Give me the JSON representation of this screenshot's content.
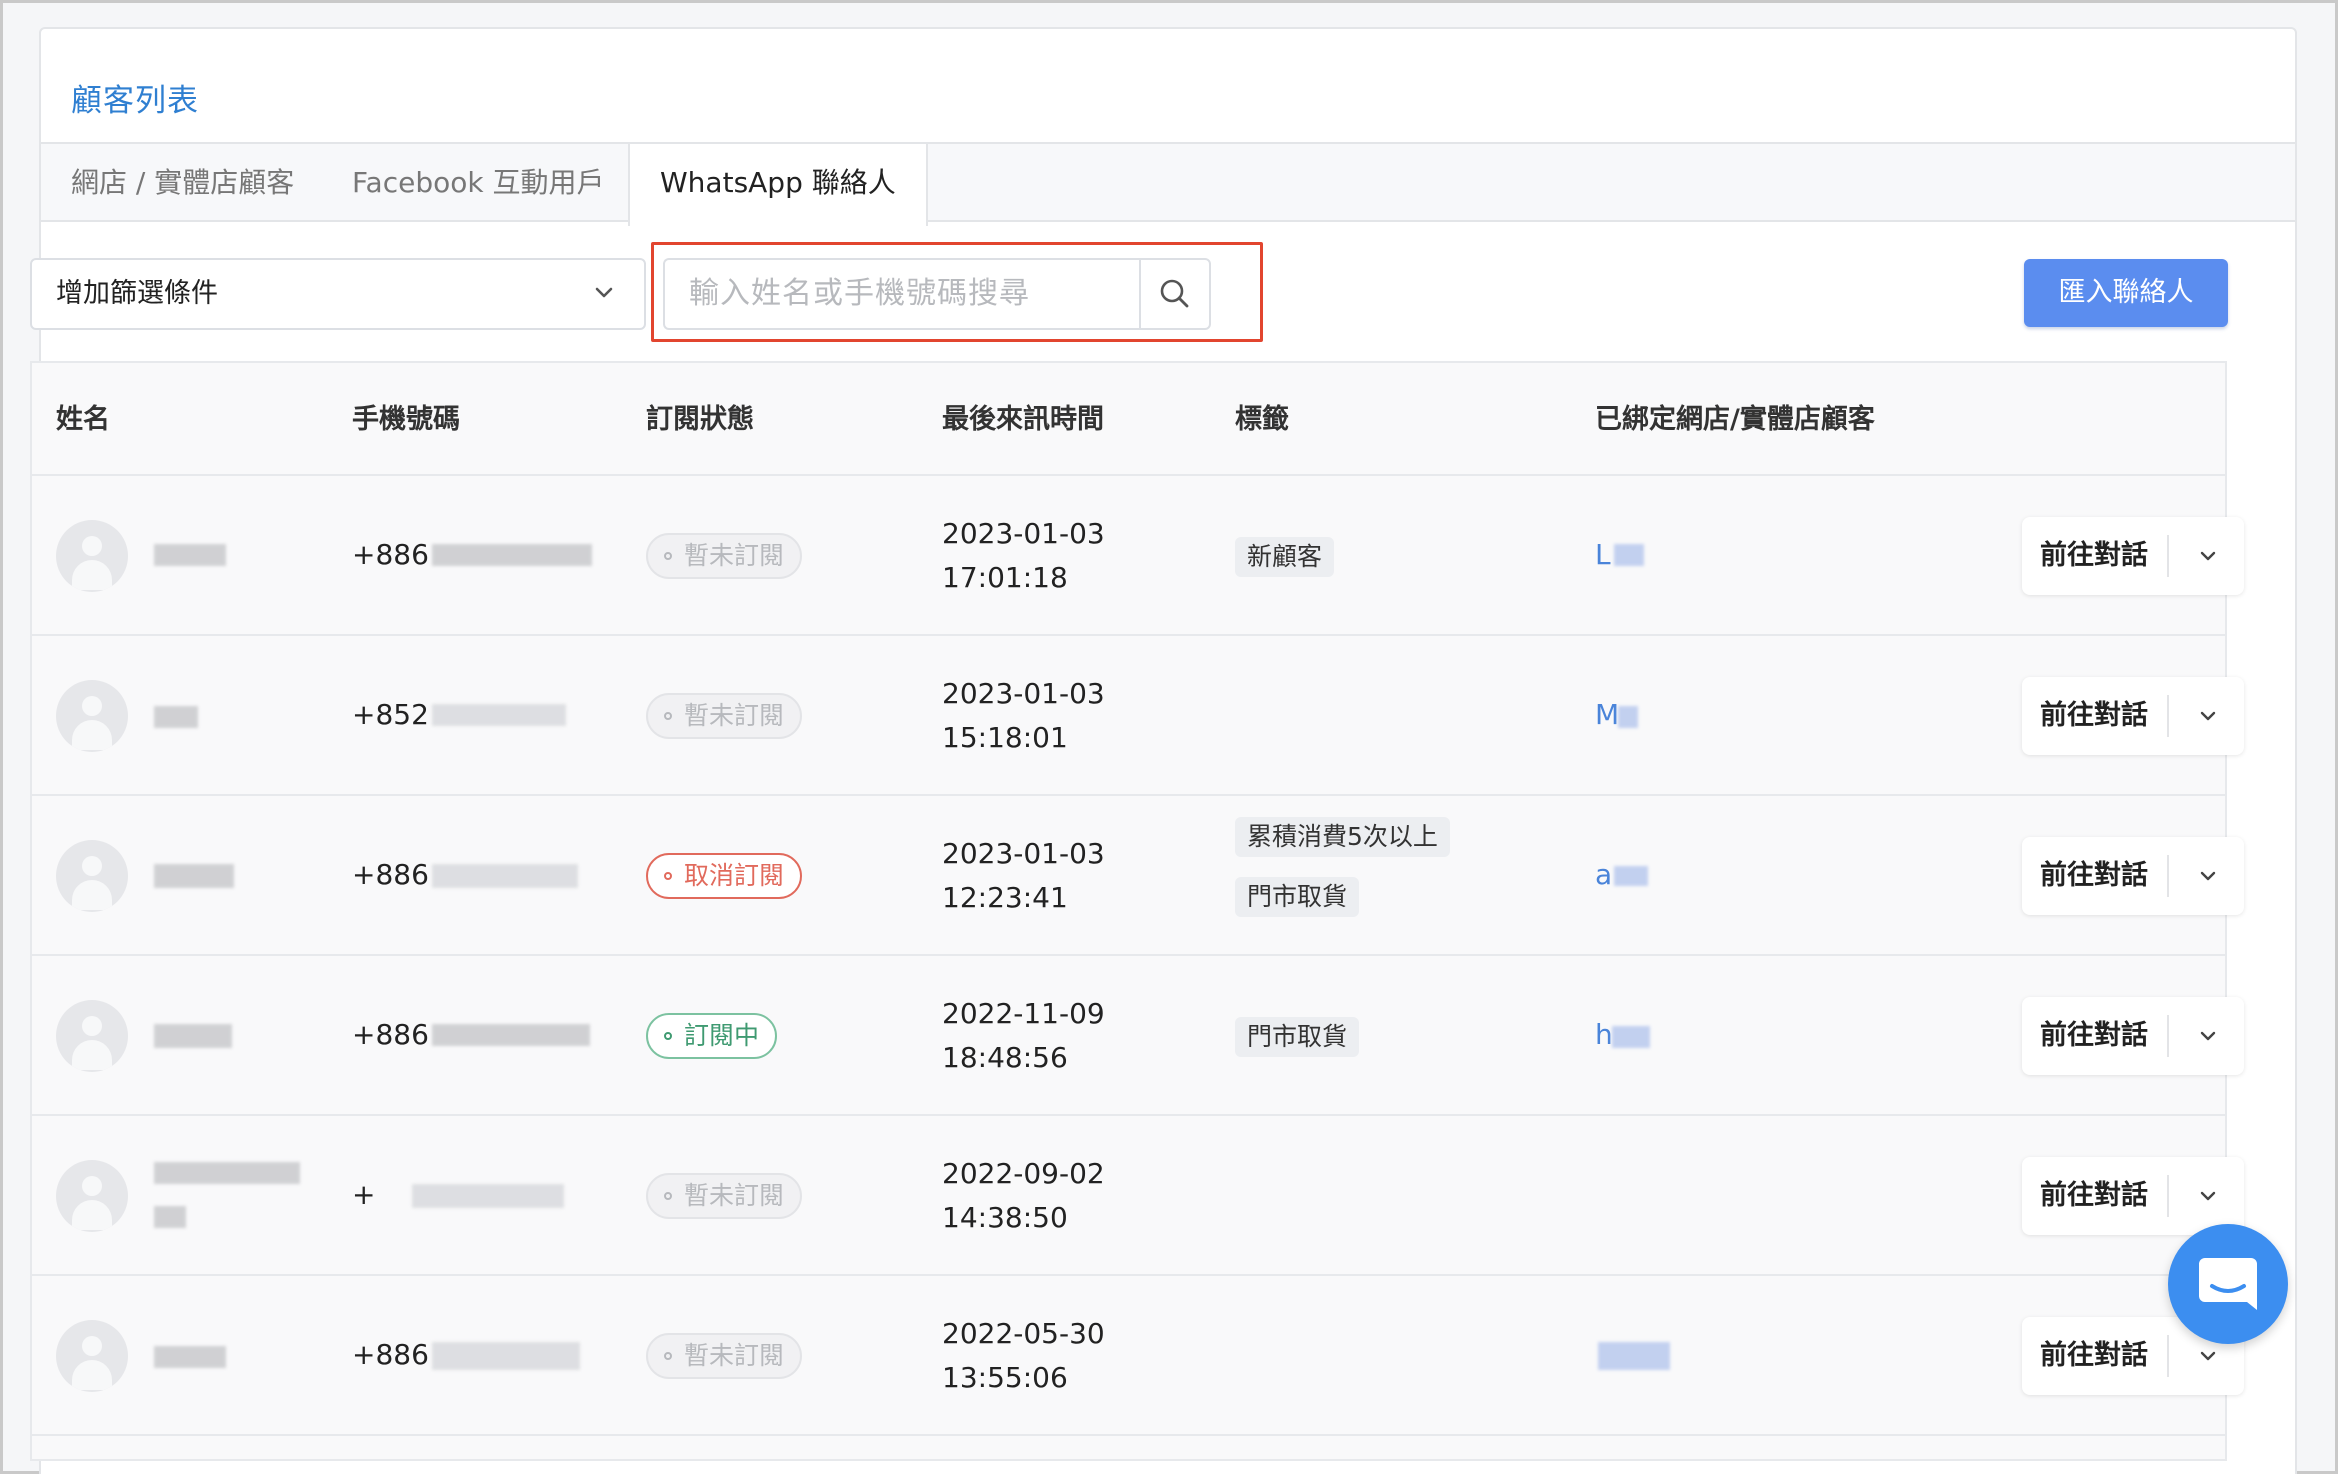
{
  "page_title": "顧客列表",
  "tabs": [
    {
      "label": "網店 / 實體店顧客"
    },
    {
      "label": "Facebook 互動用戶"
    },
    {
      "label": "WhatsApp 聯絡人"
    }
  ],
  "filter": {
    "label": "增加篩選條件"
  },
  "search": {
    "placeholder": "輸入姓名或手機號碼搜尋"
  },
  "import_button": "匯入聯絡人",
  "table": {
    "headers": [
      "姓名",
      "手機號碼",
      "訂閱狀態",
      "最後來訊時間",
      "標籤",
      "已綁定網店/實體店顧客"
    ],
    "rows": [
      {
        "phone_prefix": "+886",
        "status": "暫未訂閱",
        "date": "2023-01-03",
        "time": "17:01:18",
        "tags": [
          "新顧客"
        ],
        "bound": "L",
        "action": "前往對話"
      },
      {
        "phone_prefix": "+852",
        "status": "暫未訂閱",
        "date": "2023-01-03",
        "time": "15:18:01",
        "tags": [],
        "bound": "M",
        "action": "前往對話"
      },
      {
        "phone_prefix": "+886",
        "status": "取消訂閱",
        "date": "2023-01-03",
        "time": "12:23:41",
        "tags": [
          "累積消費5次以上",
          "門市取貨"
        ],
        "bound": "a",
        "action": "前往對話"
      },
      {
        "phone_prefix": "+886",
        "status": "訂閱中",
        "date": "2022-11-09",
        "time": "18:48:56",
        "tags": [
          "門市取貨"
        ],
        "bound": "h",
        "action": "前往對話"
      },
      {
        "phone_prefix": "+",
        "status": "暫未訂閱",
        "date": "2022-09-02",
        "time": "14:38:50",
        "tags": [],
        "bound": "",
        "action": "前往對話"
      },
      {
        "phone_prefix": "+886",
        "status": "暫未訂閱",
        "date": "2022-05-30",
        "time": "13:55:06",
        "tags": [],
        "bound": "",
        "action": "前往對話"
      }
    ]
  },
  "icons": {
    "filter_dropdown": "chevron-down-icon",
    "search": "search-icon",
    "row_menu": "chevron-down-icon",
    "chat": "chat-bubble-icon",
    "avatar": "user-placeholder-icon"
  },
  "colors": {
    "title": "#2f7fd1",
    "primary_button": "#5b8def",
    "highlight": "#e2452f",
    "cancel": "#e16a5c",
    "subscribed": "#3f9a71",
    "link": "#4a84d9",
    "chat_fab": "#3c8ef0"
  }
}
